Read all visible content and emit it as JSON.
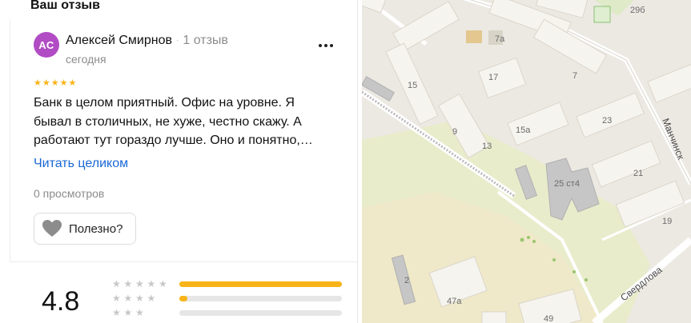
{
  "section_title": "Ваш отзыв",
  "review": {
    "avatar_initials": "АС",
    "author": "Алексей Смирнов",
    "reviews_count": "1 отзыв",
    "separator": "·",
    "date": "сегодня",
    "rating": 5,
    "text_lines": [
      "Банк в целом приятный. Офис на уровне. Я",
      "бывал в столичных, не хуже, честно скажу. А",
      "работают тут гораздо лучше. Оно и понятно,…"
    ],
    "read_more": "Читать целиком",
    "views": "0 просмотров",
    "useful_label": "Полезно?"
  },
  "rating_summary": {
    "value": "4.8",
    "distribution": [
      {
        "stars": 5,
        "fraction": 1.0
      },
      {
        "stars": 4,
        "fraction": 0.05
      },
      {
        "stars": 3,
        "fraction": 0.0
      }
    ]
  },
  "map": {
    "labels": [
      {
        "text": "29б",
        "id": "29b"
      },
      {
        "text": "7а",
        "id": "7a"
      },
      {
        "text": "15",
        "id": "15"
      },
      {
        "text": "17",
        "id": "17"
      },
      {
        "text": "7",
        "id": "7"
      },
      {
        "text": "9",
        "id": "9"
      },
      {
        "text": "13",
        "id": "13"
      },
      {
        "text": "15а",
        "id": "15a"
      },
      {
        "text": "23",
        "id": "23"
      },
      {
        "text": "25 ст4",
        "id": "25st4"
      },
      {
        "text": "21",
        "id": "21"
      },
      {
        "text": "19",
        "id": "19"
      },
      {
        "text": "2",
        "id": "2"
      },
      {
        "text": "47а",
        "id": "47a"
      },
      {
        "text": "49",
        "id": "49"
      },
      {
        "text": "Манчинск",
        "id": "manchinsk"
      },
      {
        "text": "Свердлова",
        "id": "sverdlova"
      }
    ]
  },
  "colors": {
    "star": "#f8b418",
    "link": "#1a68d6",
    "avatar": "#b14cc4"
  }
}
